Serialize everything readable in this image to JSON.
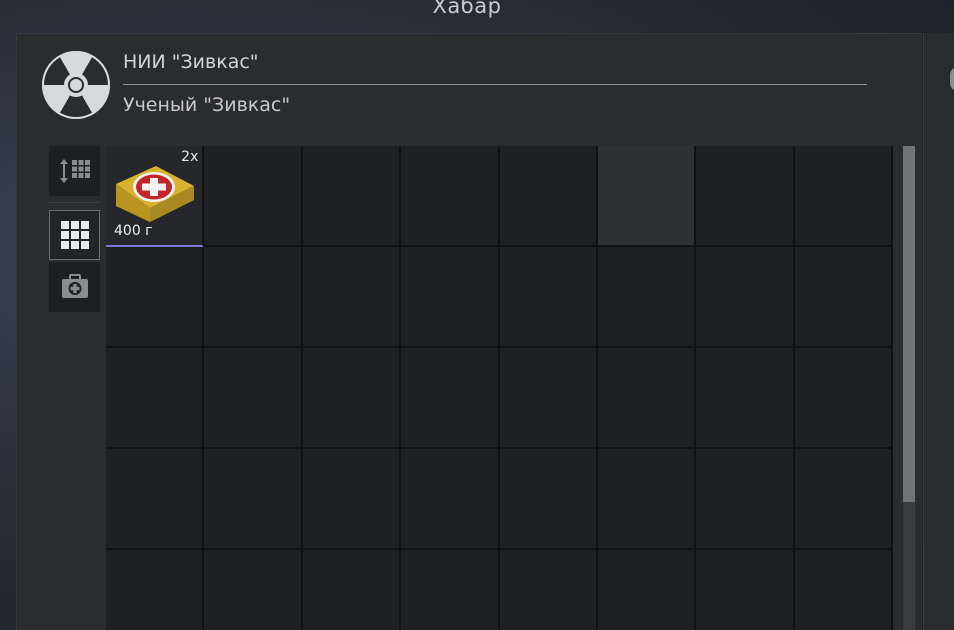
{
  "window": {
    "title": "Хабар"
  },
  "trader": {
    "faction_name": "НИИ \"Зивкас\"",
    "npc_name": "Ученый \"Зивкас\"",
    "faction_icon": "radiation-icon"
  },
  "side_tools": [
    {
      "icon": "sort-grid-icon"
    },
    {
      "icon": "grid-view-icon",
      "selected": true
    },
    {
      "icon": "medkit-filter-icon"
    }
  ],
  "inventory": {
    "columns": 8,
    "visible_rows": 5,
    "items": [
      {
        "name": "medkit",
        "icon": "medkit-icon",
        "quantity": "2x",
        "weight": "400 г",
        "slot": 0
      }
    ]
  },
  "colors": {
    "panel": "#2b2c2e",
    "cell": "#1f2022",
    "selection_underline": "#7e79d8",
    "medkit_yellow": "#d8b22e",
    "medkit_red": "#c2262b"
  }
}
